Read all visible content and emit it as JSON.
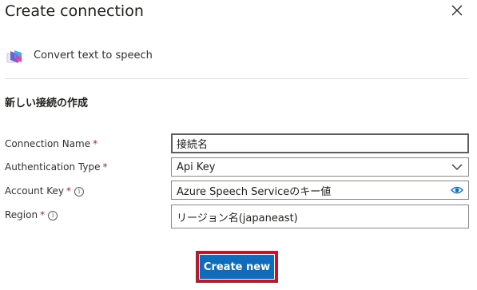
{
  "dialog": {
    "title": "Create connection"
  },
  "connector": {
    "name": "Convert text to speech",
    "icon": "speech-service-icon"
  },
  "section": {
    "title": "新しい接続の作成"
  },
  "fields": {
    "connection_name": {
      "label": "Connection Name",
      "required": "*",
      "value": "接続名"
    },
    "auth_type": {
      "label": "Authentication Type",
      "required": "*",
      "value": "Api Key"
    },
    "account_key": {
      "label": "Account Key",
      "required": "*",
      "value": "Azure Speech Serviceのキー値",
      "icon": "eye-icon"
    },
    "region": {
      "label": "Region",
      "required": "*",
      "value": "リージョン名(japaneast)"
    }
  },
  "actions": {
    "create_label": "Create new"
  },
  "colors": {
    "primary": "#0f6cbd",
    "required": "#a4262c",
    "highlight_outline": "#c2142b"
  }
}
